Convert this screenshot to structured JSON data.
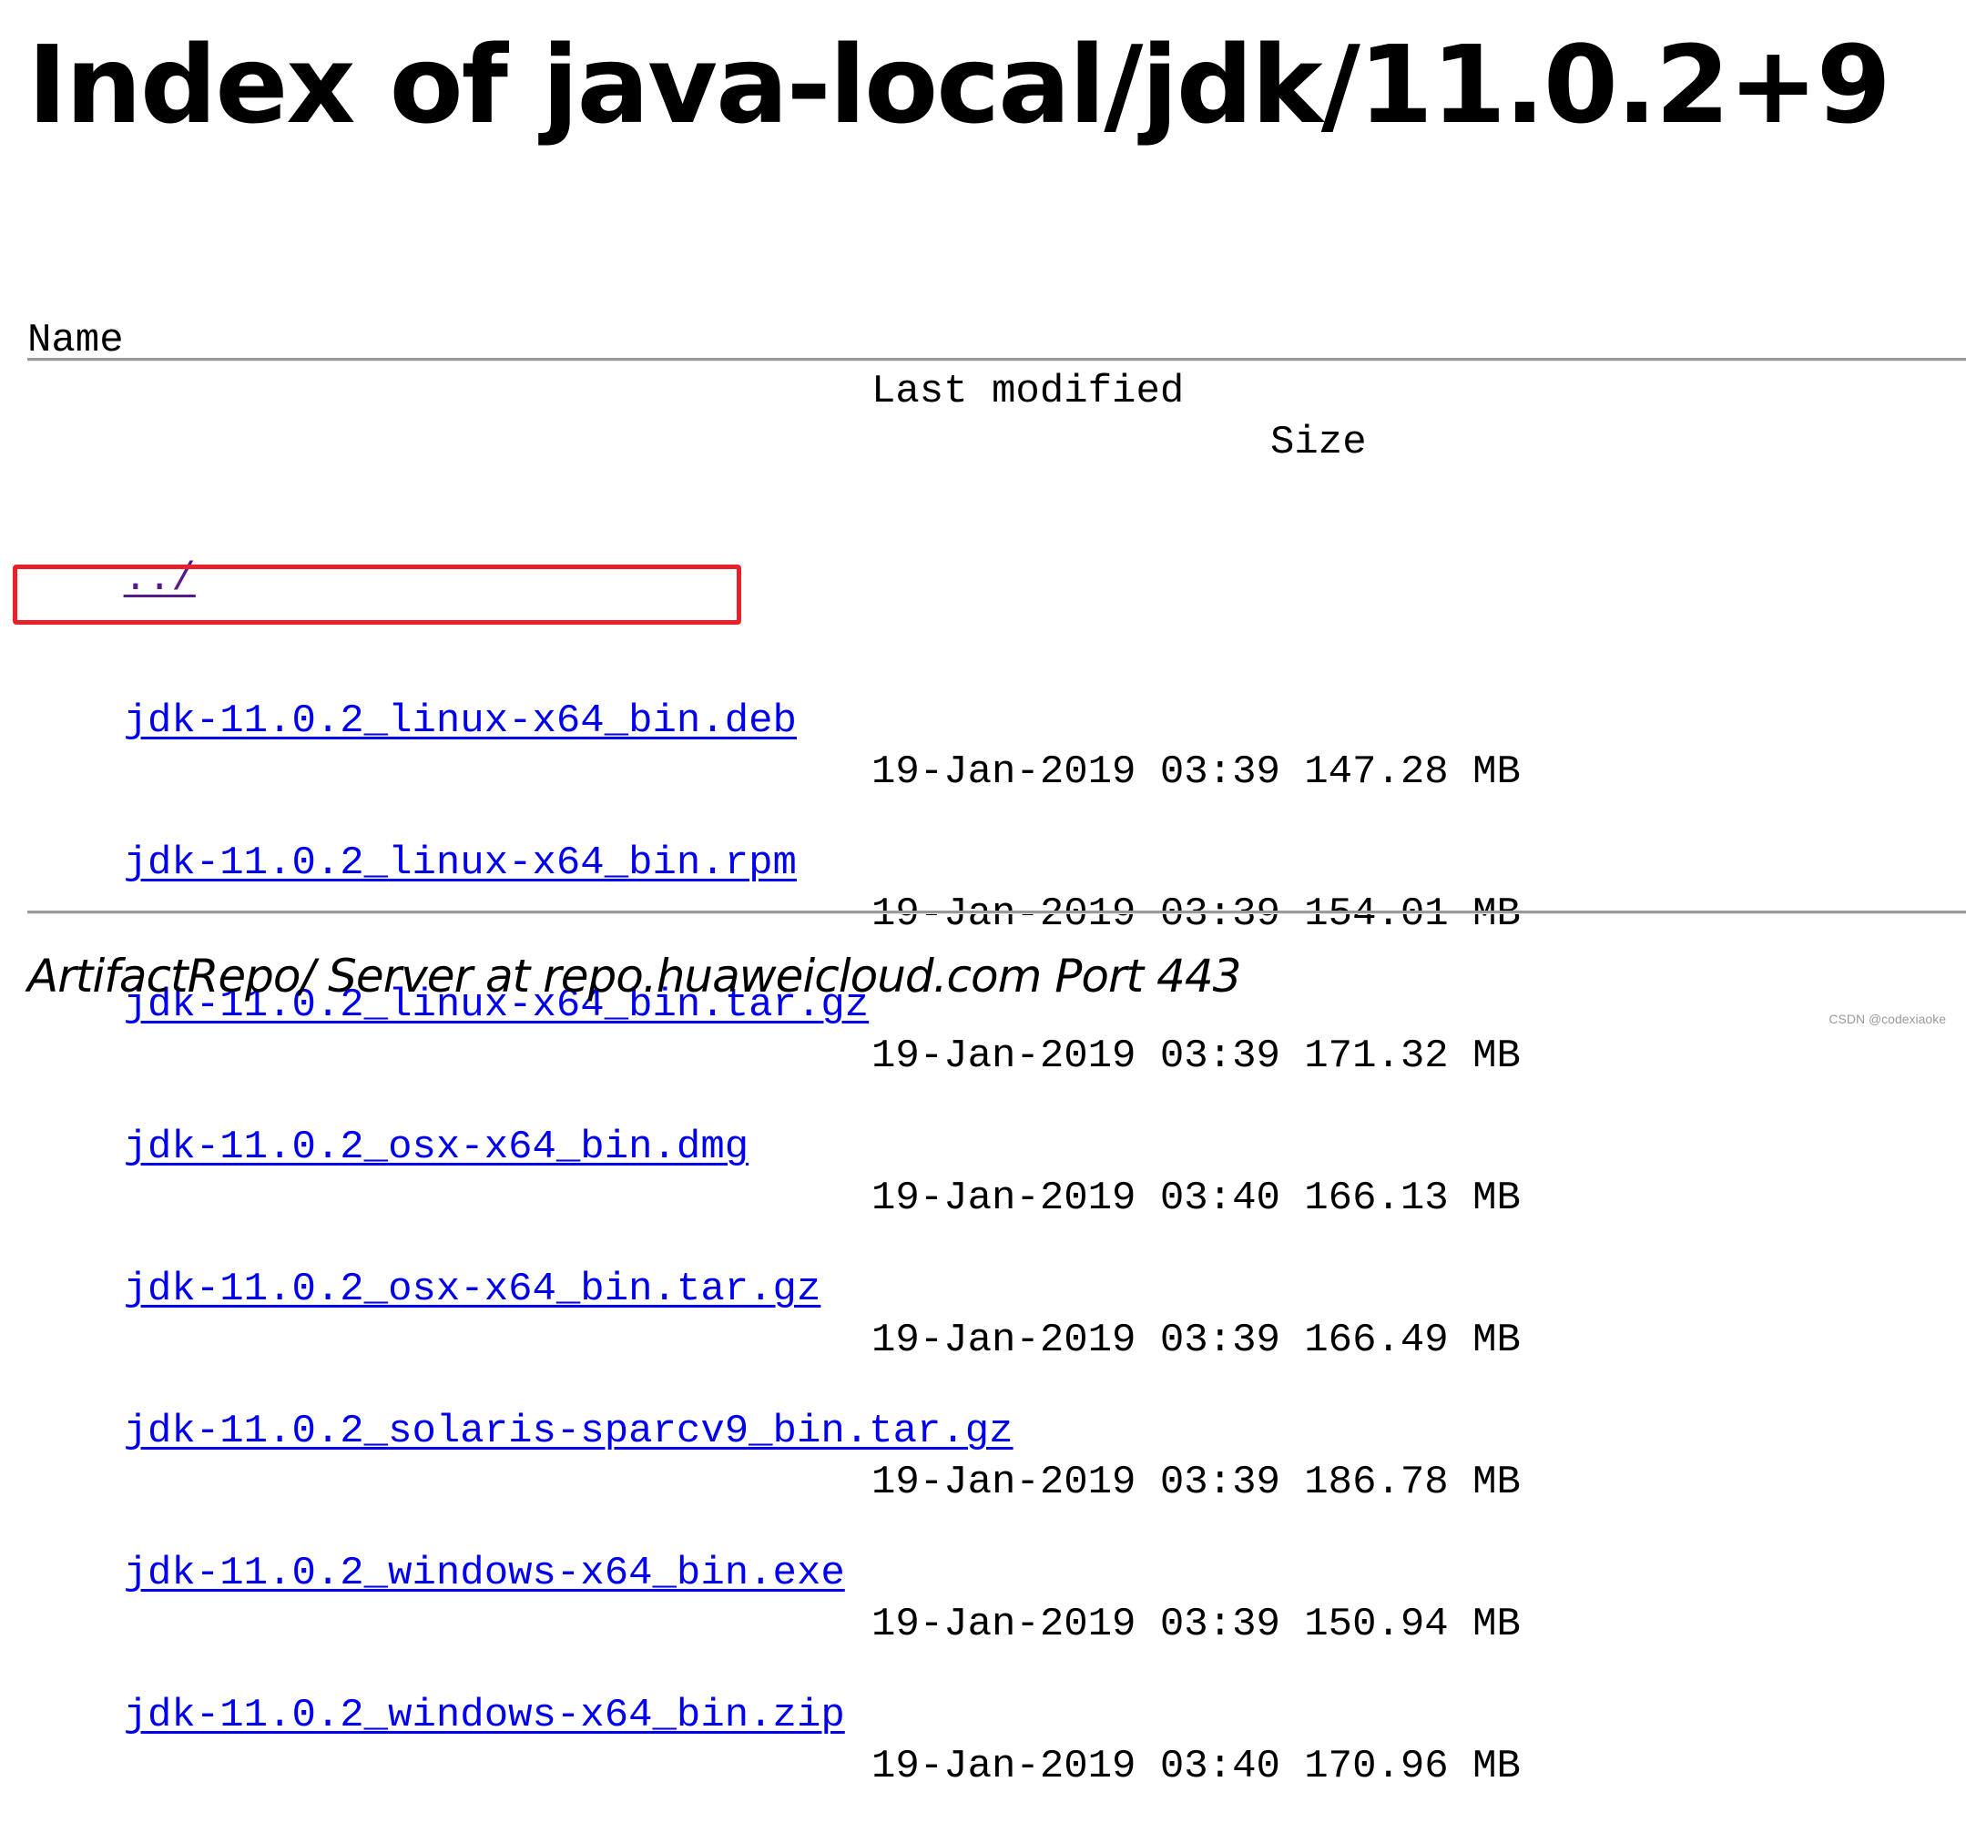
{
  "page": {
    "title": "Index of java-local/jdk/11.0.2+9"
  },
  "table": {
    "headers": {
      "name": "Name",
      "last_modified": "Last modified",
      "size": "Size"
    },
    "parent": {
      "name": "../"
    },
    "rows": [
      {
        "name": "jdk-11.0.2_linux-x64_bin.deb",
        "date": "19-Jan-2019 03:39",
        "size": "147.28 MB"
      },
      {
        "name": "jdk-11.0.2_linux-x64_bin.rpm",
        "date": "19-Jan-2019 03:39",
        "size": "154.01 MB"
      },
      {
        "name": "jdk-11.0.2_linux-x64_bin.tar.gz",
        "date": "19-Jan-2019 03:39",
        "size": "171.32 MB",
        "highlighted": true
      },
      {
        "name": "jdk-11.0.2_osx-x64_bin.dmg",
        "date": "19-Jan-2019 03:40",
        "size": "166.13 MB"
      },
      {
        "name": "jdk-11.0.2_osx-x64_bin.tar.gz",
        "date": "19-Jan-2019 03:39",
        "size": "166.49 MB"
      },
      {
        "name": "jdk-11.0.2_solaris-sparcv9_bin.tar.gz",
        "date": "19-Jan-2019 03:39",
        "size": "186.78 MB"
      },
      {
        "name": "jdk-11.0.2_windows-x64_bin.exe",
        "date": "19-Jan-2019 03:39",
        "size": "150.94 MB"
      },
      {
        "name": "jdk-11.0.2_windows-x64_bin.zip",
        "date": "19-Jan-2019 03:40",
        "size": "170.96 MB"
      }
    ]
  },
  "footer": {
    "server_signature": "ArtifactRepo/ Server at repo.huaweicloud.com Port 443"
  },
  "watermark": "CSDN @codexiaoke",
  "colors": {
    "link": "#0000ee",
    "visited_link": "#551a8b",
    "highlight_box": "#e8202a"
  }
}
